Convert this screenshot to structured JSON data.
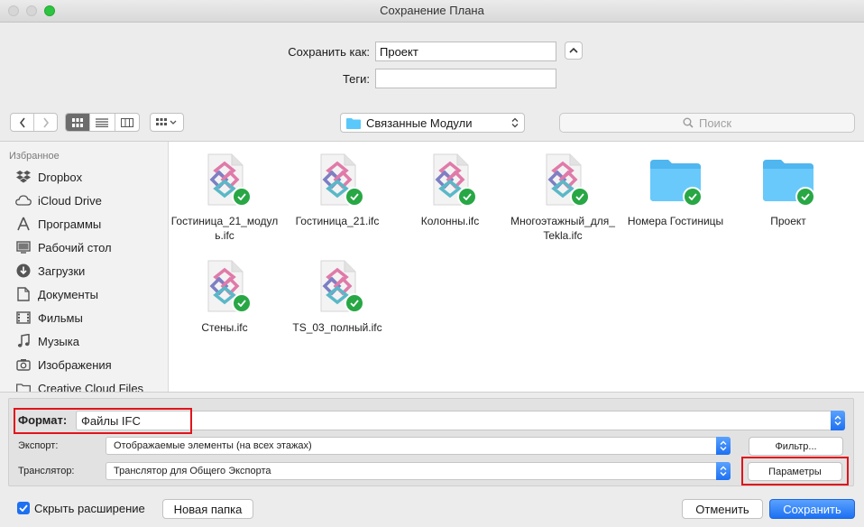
{
  "window": {
    "title": "Сохранение Плана"
  },
  "save": {
    "label": "Сохранить как:",
    "value": "Проект",
    "tags_label": "Теги:",
    "tags_value": ""
  },
  "toolbar": {
    "location": "Связанные Модули",
    "search_placeholder": "Поиск"
  },
  "sidebar": {
    "heading": "Избранное",
    "items": [
      {
        "label": "Dropbox",
        "icon": "dropbox-icon"
      },
      {
        "label": "iCloud Drive",
        "icon": "cloud-icon"
      },
      {
        "label": "Программы",
        "icon": "applications-icon"
      },
      {
        "label": "Рабочий стол",
        "icon": "desktop-icon"
      },
      {
        "label": "Загрузки",
        "icon": "downloads-icon"
      },
      {
        "label": "Документы",
        "icon": "documents-icon"
      },
      {
        "label": "Фильмы",
        "icon": "movies-icon"
      },
      {
        "label": "Музыка",
        "icon": "music-icon"
      },
      {
        "label": "Изображения",
        "icon": "pictures-icon"
      },
      {
        "label": "Creative Cloud Files",
        "icon": "folder-icon"
      }
    ]
  },
  "files": [
    {
      "name": "Гостиница_21_модуль.ifc",
      "kind": "ifc-file-icon"
    },
    {
      "name": "Гостиница_21.ifc",
      "kind": "ifc-file-icon"
    },
    {
      "name": "Колонны.ifc",
      "kind": "ifc-file-icon"
    },
    {
      "name": "Многоэтажный_для_Tekla.ifc",
      "kind": "ifc-file-icon"
    },
    {
      "name": "Номера Гостиницы",
      "kind": "folder-icon"
    },
    {
      "name": "Проект",
      "kind": "folder-icon"
    },
    {
      "name": "Стены.ifc",
      "kind": "ifc-file-icon"
    },
    {
      "name": "TS_03_полный.ifc",
      "kind": "ifc-file-icon"
    }
  ],
  "options": {
    "format_label": "Формат:",
    "format_value": "Файлы IFC",
    "export_label": "Экспорт:",
    "export_value": "Отображаемые элементы (на всех этажах)",
    "translator_label": "Транслятор:",
    "translator_value": "Транслятор для Общего Экспорта",
    "filter_button": "Фильтр...",
    "params_button": "Параметры"
  },
  "bottom": {
    "hide_ext_label": "Скрыть расширение",
    "hide_ext_checked": true,
    "new_folder": "Новая папка",
    "cancel": "Отменить",
    "save": "Сохранить"
  },
  "colors": {
    "accent": "#1d70f2",
    "badge": "#28a745",
    "folder": "#5ac8fa",
    "highlight": "#e0141b"
  }
}
